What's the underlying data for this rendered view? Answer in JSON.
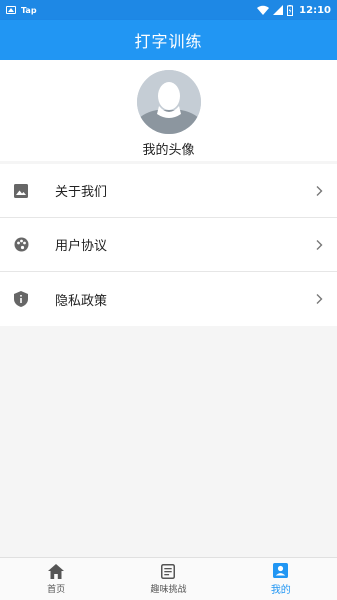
{
  "status_bar": {
    "app_name": "Tap",
    "time": "12:10"
  },
  "app_bar": {
    "title": "打字训练"
  },
  "profile": {
    "avatar_label": "我的头像"
  },
  "menu": {
    "items": [
      {
        "label": "关于我们",
        "icon": "image-icon"
      },
      {
        "label": "用户协议",
        "icon": "palette-icon"
      },
      {
        "label": "隐私政策",
        "icon": "shield-info-icon"
      }
    ]
  },
  "bottom_nav": {
    "items": [
      {
        "label": "首页",
        "icon": "home-icon"
      },
      {
        "label": "趣味挑战",
        "icon": "article-icon"
      },
      {
        "label": "我的",
        "icon": "account-box-icon",
        "active": true
      }
    ]
  },
  "colors": {
    "primary": "#2196f3",
    "status_bar": "#1e88e5",
    "icon_gray": "#666666"
  }
}
